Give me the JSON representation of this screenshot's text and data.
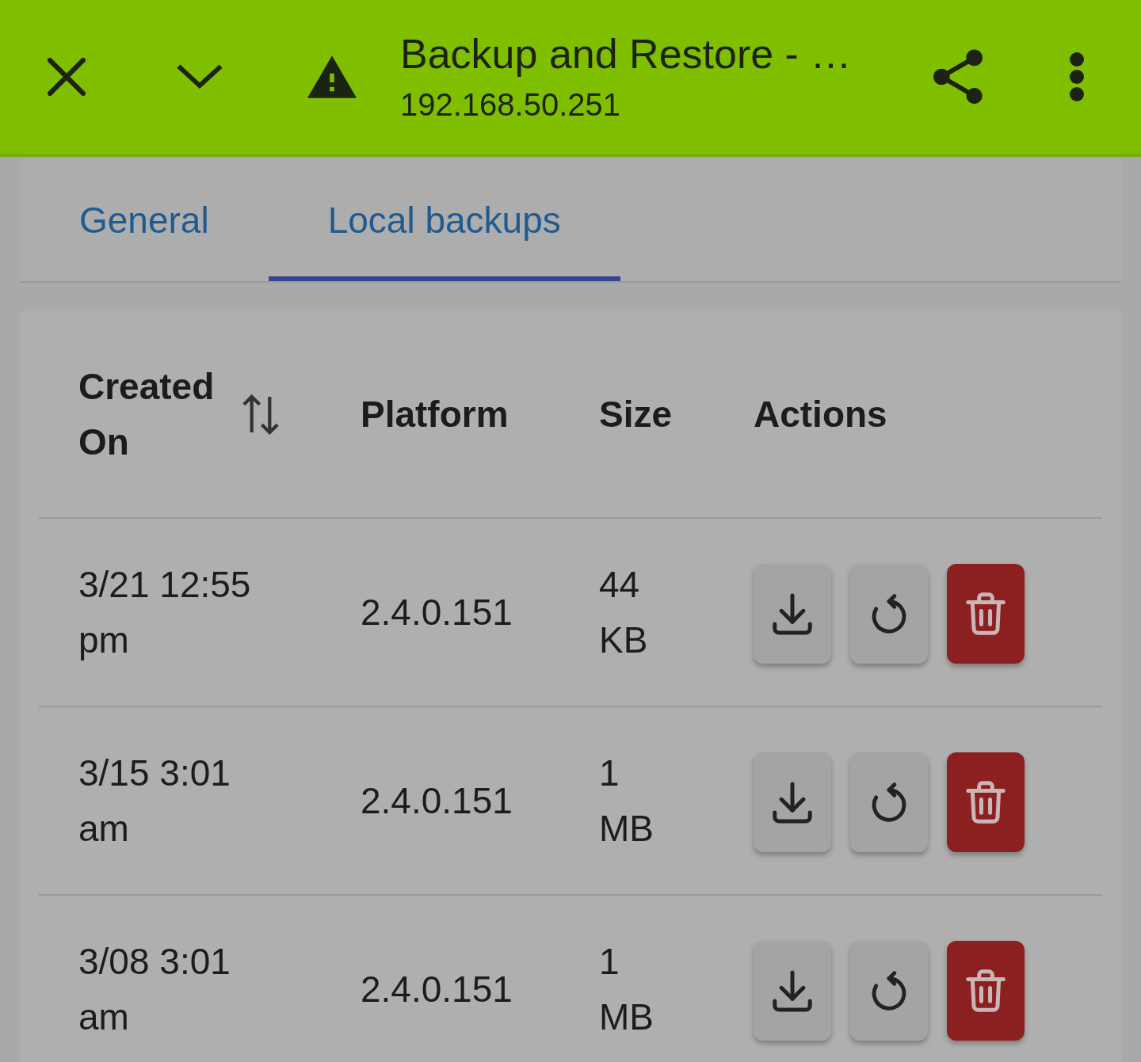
{
  "header": {
    "title": "Backup and Restore - …",
    "subtitle": "192.168.50.251"
  },
  "tabs": [
    {
      "label": "General",
      "selected": false
    },
    {
      "label": "Local backups",
      "selected": true
    }
  ],
  "table": {
    "columns": [
      {
        "label": "Created On",
        "sortable": true
      },
      {
        "label": "Platform",
        "sortable": false
      },
      {
        "label": "Size",
        "sortable": false
      },
      {
        "label": "Actions",
        "sortable": false
      }
    ],
    "rows": [
      {
        "created_on": "3/21 12:55 pm",
        "platform": "2.4.0.151",
        "size": "44 KB"
      },
      {
        "created_on": "3/15 3:01 am",
        "platform": "2.4.0.151",
        "size": "1 MB"
      },
      {
        "created_on": "3/08 3:01 am",
        "platform": "2.4.0.151",
        "size": "1 MB"
      }
    ]
  }
}
